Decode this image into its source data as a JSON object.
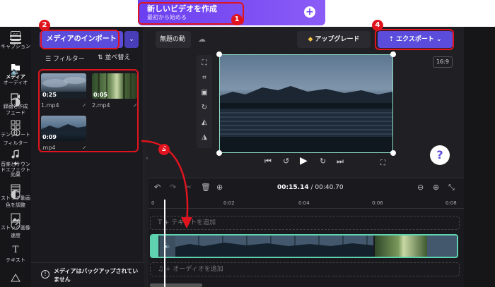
{
  "create": {
    "title": "新しいビデオを作成",
    "subtitle": "最初から始める"
  },
  "sidebar": {
    "items": [
      {
        "label": "メディア"
      },
      {
        "label": "録画と作成"
      },
      {
        "label": "テンプレート"
      },
      {
        "label": "音楽とサウンドエフェクト"
      },
      {
        "label": "ストック動画"
      },
      {
        "label": "ストック画像"
      },
      {
        "label": "テキスト"
      }
    ]
  },
  "media": {
    "import_label": "メディアのインポート",
    "filter_label": "フィルター",
    "sort_label": "並べ替え",
    "items": [
      {
        "name": "1.mp4",
        "duration": "0:25"
      },
      {
        "name": "2.mp4",
        "duration": "0:05"
      },
      {
        "name": ".mp4",
        "duration": "0:09"
      }
    ],
    "backup_notice": "メディアはバックアップされていません"
  },
  "header": {
    "project_title": "無題の動",
    "upgrade_label": "アップグレード",
    "export_label": "エクスポート",
    "ratio": "16:9"
  },
  "timeline": {
    "current_time": "00:15.14",
    "total_time": "/ 00:40.70",
    "ruler": [
      "0",
      "0:02",
      "0:04",
      "0:06",
      "0:08"
    ],
    "text_track": "+ テキストを追加",
    "audio_track": "+ オーディオを追加"
  },
  "right_panel": {
    "items": [
      {
        "label": "キャプション"
      },
      {
        "label": "オーディオ"
      },
      {
        "label": "フェード"
      },
      {
        "label": "フィルター"
      },
      {
        "label": "効果"
      },
      {
        "label": "色を調整"
      },
      {
        "label": "速度"
      }
    ]
  },
  "annotations": [
    "1",
    "2",
    "3",
    "4"
  ],
  "colors": {
    "accent": "#5b4cdb",
    "annotation": "#e0141e",
    "clip_border": "#5fd2b0"
  }
}
